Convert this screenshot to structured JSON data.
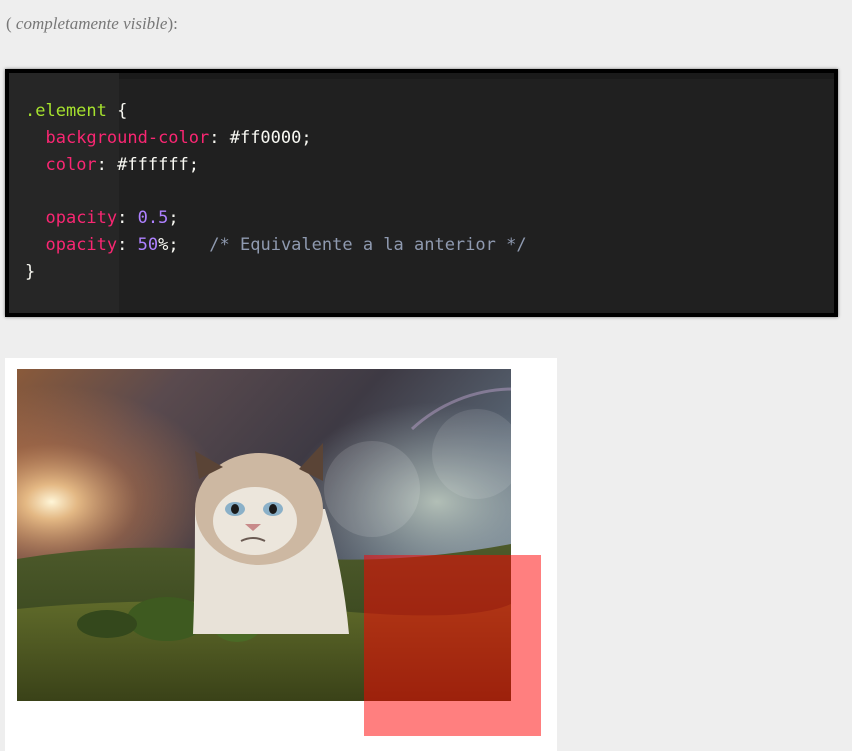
{
  "intro": {
    "open": "(",
    "emphasis": "completamente visible",
    "close": "):"
  },
  "code": {
    "lines": [
      [
        {
          "t": "selector",
          "v": ".element"
        },
        {
          "t": "plain",
          "v": " {"
        }
      ],
      [
        {
          "t": "plain",
          "v": "  "
        },
        {
          "t": "prop",
          "v": "background-color"
        },
        {
          "t": "plain",
          "v": ": #ff0000;"
        }
      ],
      [
        {
          "t": "plain",
          "v": "  "
        },
        {
          "t": "prop",
          "v": "color"
        },
        {
          "t": "plain",
          "v": ": #ffffff;"
        }
      ],
      [],
      [
        {
          "t": "plain",
          "v": "  "
        },
        {
          "t": "prop",
          "v": "opacity"
        },
        {
          "t": "plain",
          "v": ": "
        },
        {
          "t": "num",
          "v": "0.5"
        },
        {
          "t": "plain",
          "v": ";"
        }
      ],
      [
        {
          "t": "plain",
          "v": "  "
        },
        {
          "t": "prop",
          "v": "opacity"
        },
        {
          "t": "plain",
          "v": ": "
        },
        {
          "t": "num",
          "v": "50"
        },
        {
          "t": "plain",
          "v": "%;   "
        },
        {
          "t": "comment",
          "v": "/* Equivalente a la anterior */"
        }
      ],
      [
        {
          "t": "plain",
          "v": "}"
        }
      ]
    ]
  },
  "demo": {
    "overlay_color": "#ff0000",
    "overlay_opacity": 0.5,
    "photo_subject": "grumpy-cat-landscape"
  },
  "colors": {
    "page_bg": "#eeeeee",
    "code_bg": "#202020",
    "selector": "#a6e22e",
    "property": "#f92672",
    "number": "#ae81ff",
    "comment": "#8f9ab0"
  }
}
